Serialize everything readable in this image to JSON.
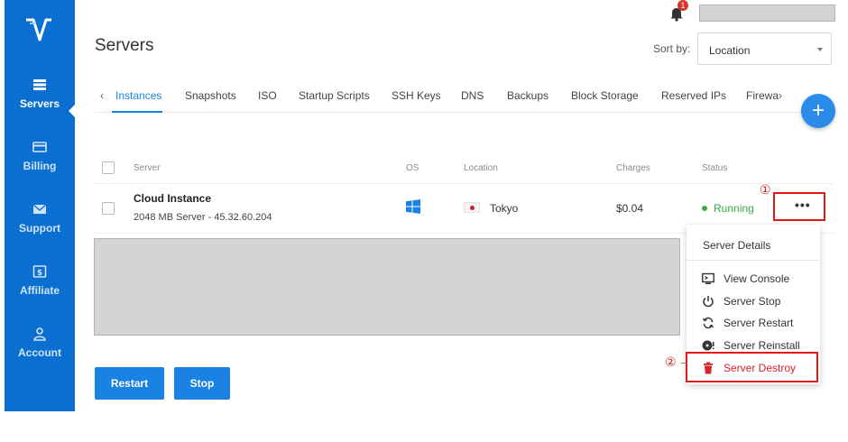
{
  "sidebar": {
    "logo_icon": "vultr-v-logo",
    "items": [
      {
        "label": "Servers",
        "icon": "server-stack-icon",
        "active": true
      },
      {
        "label": "Billing",
        "icon": "credit-card-icon",
        "active": false
      },
      {
        "label": "Support",
        "icon": "envelope-icon",
        "active": false
      },
      {
        "label": "Affiliate",
        "icon": "dollar-icon",
        "active": false
      },
      {
        "label": "Account",
        "icon": "user-icon",
        "active": false
      }
    ]
  },
  "header": {
    "title": "Servers",
    "notification_count": "1",
    "sort_label": "Sort by:",
    "sort_value": "Location"
  },
  "tabs": [
    "Instances",
    "Snapshots",
    "ISO",
    "Startup Scripts",
    "SSH Keys",
    "DNS",
    "Backups",
    "Block Storage",
    "Reserved IPs",
    "Firewa"
  ],
  "active_tab": "Instances",
  "fab_label": "+",
  "table": {
    "columns": [
      "Server",
      "OS",
      "Location",
      "Charges",
      "Status"
    ],
    "rows": [
      {
        "name": "Cloud Instance",
        "details": "2048 MB Server - 45.32.60.204",
        "os_icon": "windows-icon",
        "location": "Tokyo",
        "charges": "$0.04",
        "status": "Running"
      }
    ]
  },
  "markers": {
    "step1": "①",
    "step2": "②"
  },
  "more_label": "•••",
  "buttons": {
    "restart": "Restart",
    "stop": "Stop"
  },
  "menu": {
    "header": "Server Details",
    "items": [
      {
        "label": "View Console",
        "icon": "console-icon"
      },
      {
        "label": "Server Stop",
        "icon": "power-icon"
      },
      {
        "label": "Server Restart",
        "icon": "refresh-icon"
      },
      {
        "label": "Server Reinstall",
        "icon": "disc-icon"
      },
      {
        "label": "Server Destroy",
        "icon": "trash-icon"
      }
    ]
  },
  "colors": {
    "sidebar": "#0a6fd1",
    "accent": "#1a82e2",
    "status_running": "#3aa84b",
    "danger": "#d8232a",
    "highlight": "#e01818"
  }
}
